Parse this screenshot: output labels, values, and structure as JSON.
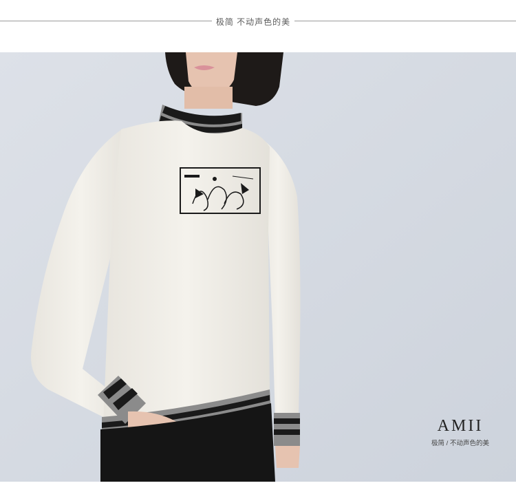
{
  "header": {
    "tagline": "极简 不动声色的美"
  },
  "product_photo": {
    "subject": "woman wearing white knit sweater with striped mock-neck collar and cuffs, line-art graphic on chest",
    "colors": {
      "backdrop": "#d6dbe3",
      "sweater": "#f0ede6",
      "stripe_dark": "#1a1a1a",
      "stripe_grey": "#8b8b8b",
      "hair": "#1e1a18",
      "skin": "#e6c3b0",
      "trousers": "#151515"
    }
  },
  "brand": {
    "logo": "AMII",
    "tagline": "极简 / 不动声色的美"
  }
}
